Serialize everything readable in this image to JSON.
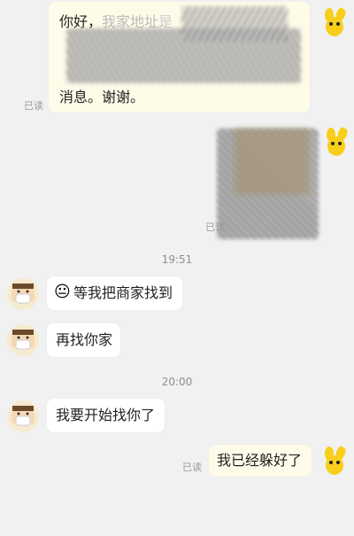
{
  "messages": {
    "m1": {
      "line1_a": "你好，",
      "line1_b": "我家地址",
      "line1_c": "是",
      "line2": "消息。谢谢。",
      "read": "已读"
    },
    "m2": {
      "read": "已读"
    },
    "t1": "19:51",
    "m3": {
      "emoji": "😐",
      "text": "等我把商家找到"
    },
    "m4": {
      "text": "再找你家"
    },
    "t2": "20:00",
    "m5": {
      "text": "我要开始找你了"
    },
    "m6": {
      "text": "我已经躲好了",
      "read": "已读"
    }
  },
  "colors": {
    "self_bubble": "#fffbe9",
    "other_bubble": "#ffffff",
    "background": "#f1f1f1",
    "avatar_yellow": "#f7cf1a"
  }
}
